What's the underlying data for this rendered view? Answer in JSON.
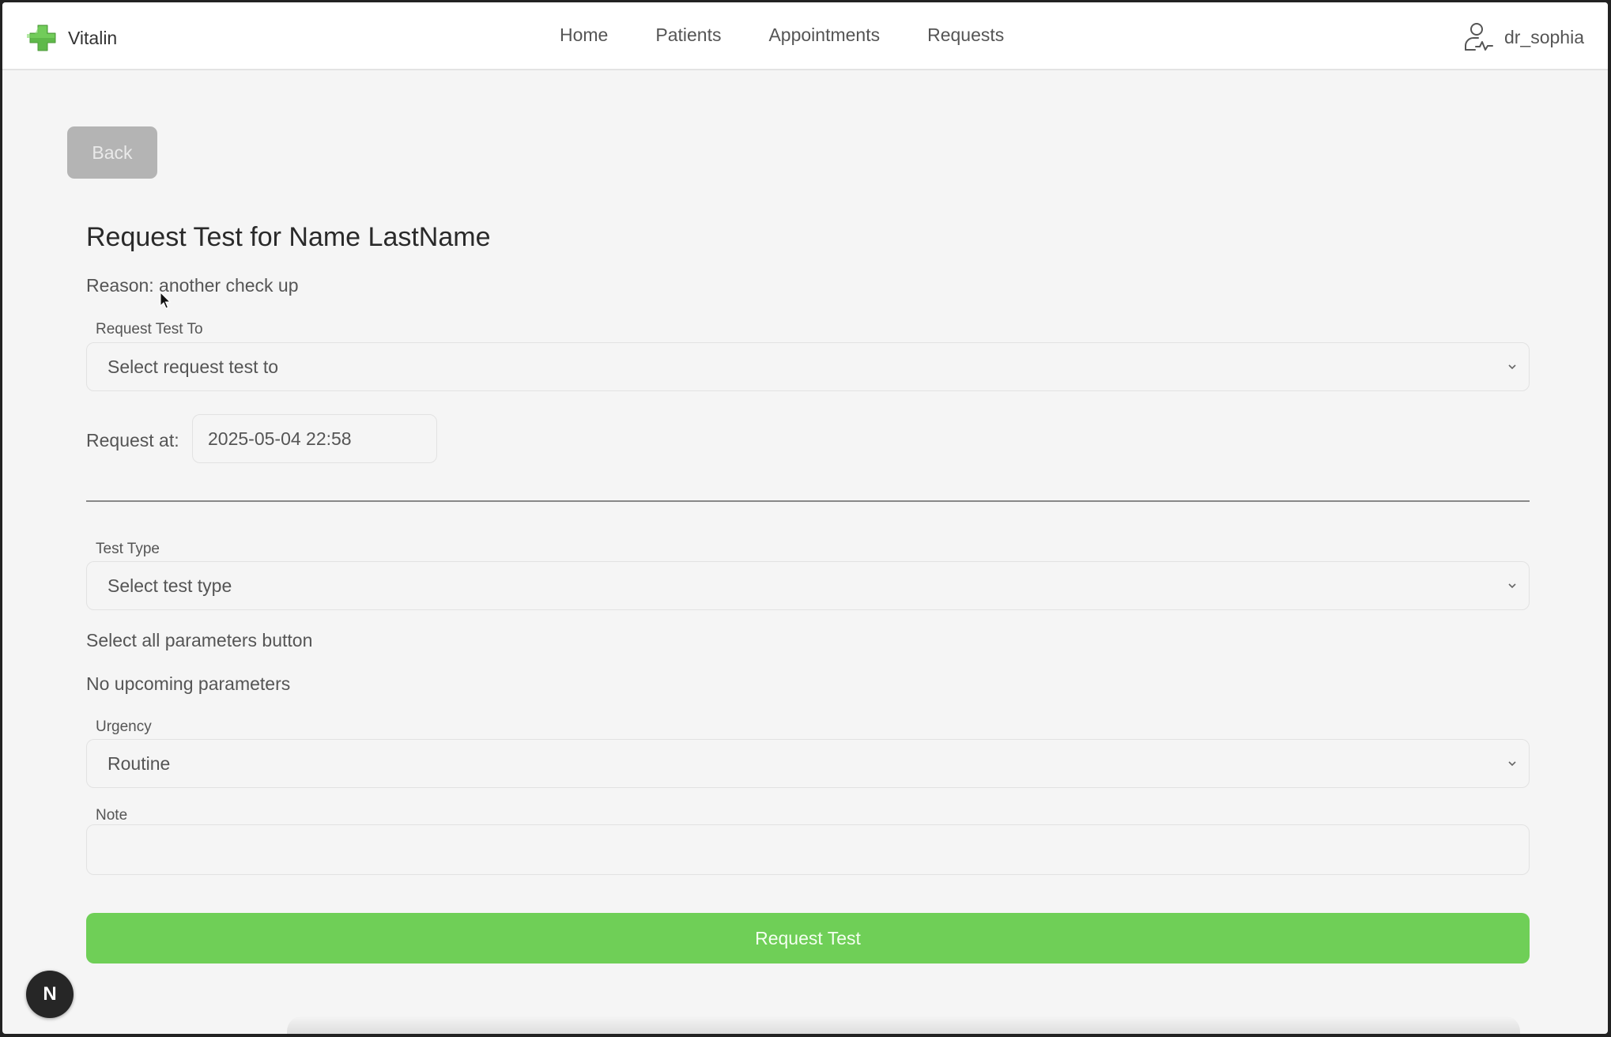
{
  "app": {
    "name": "Vitalin",
    "logo_icon": "green-cross-icon",
    "brand_color": "#6fcf57"
  },
  "nav": {
    "items": [
      {
        "label": "Home"
      },
      {
        "label": "Patients"
      },
      {
        "label": "Appointments"
      },
      {
        "label": "Requests"
      }
    ]
  },
  "user": {
    "name": "dr_sophia",
    "icon": "doctor-user-icon"
  },
  "back_button": {
    "label": "Back"
  },
  "form": {
    "title": "Request Test for Name LastName",
    "reason": "Reason: another check up",
    "request_test_to": {
      "label": "Request Test To",
      "value": "Select request test to"
    },
    "request_at": {
      "label": "Request at:",
      "value": "2025-05-04 22:58"
    },
    "test_type": {
      "label": "Test Type",
      "value": "Select test type"
    },
    "select_all_text": "Select all parameters button",
    "no_parameters_text": "No upcoming parameters",
    "urgency": {
      "label": "Urgency",
      "value": "Routine"
    },
    "note": {
      "label": "Note",
      "value": ""
    },
    "submit_label": "Request Test"
  },
  "dev_badge": {
    "label": "N"
  }
}
